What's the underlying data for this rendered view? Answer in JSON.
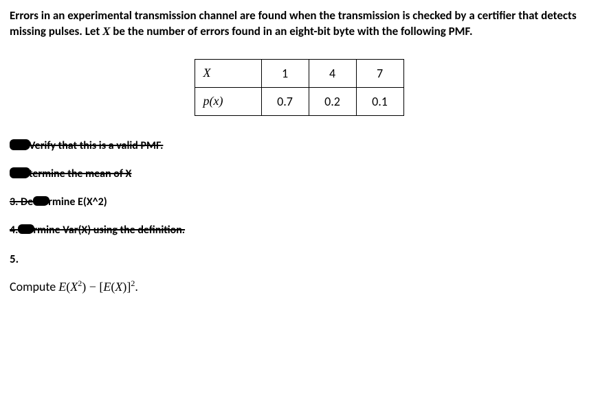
{
  "intro": {
    "text_before_X": "Errors in an experimental transmission channel are found when the transmission is checked by a certifier that detects missing pulses. Let ",
    "X": "X",
    "text_after_X": " be the number of errors found in an eight-bit byte with the following PMF."
  },
  "table": {
    "row1": {
      "lead": "X",
      "c1": "1",
      "c2": "4",
      "c3": "7"
    },
    "row2": {
      "lead": "p(x)",
      "c1": "0.7",
      "c2": "0.2",
      "c3": "0.1"
    }
  },
  "items": {
    "i1": "Verify that this is a valid PMF.",
    "i2": "termine the mean of X",
    "i3_strike": "3. De",
    "i3_rest": "rmine E(X^2)",
    "i4": "rmine Var(X) using the definition.",
    "i5_label": "5."
  },
  "compute": {
    "word": "Compute ",
    "expr_E": "E",
    "expr_X": "X",
    "sq": "2",
    "minus": " − [",
    "close": ")]",
    "period": "."
  },
  "chart_data": {
    "type": "table",
    "columns": [
      "X",
      "p(x)"
    ],
    "rows": [
      {
        "X": 1,
        "p(x)": 0.7
      },
      {
        "X": 4,
        "p(x)": 0.2
      },
      {
        "X": 7,
        "p(x)": 0.1
      }
    ],
    "title": "PMF of number of errors in an eight-bit byte"
  }
}
